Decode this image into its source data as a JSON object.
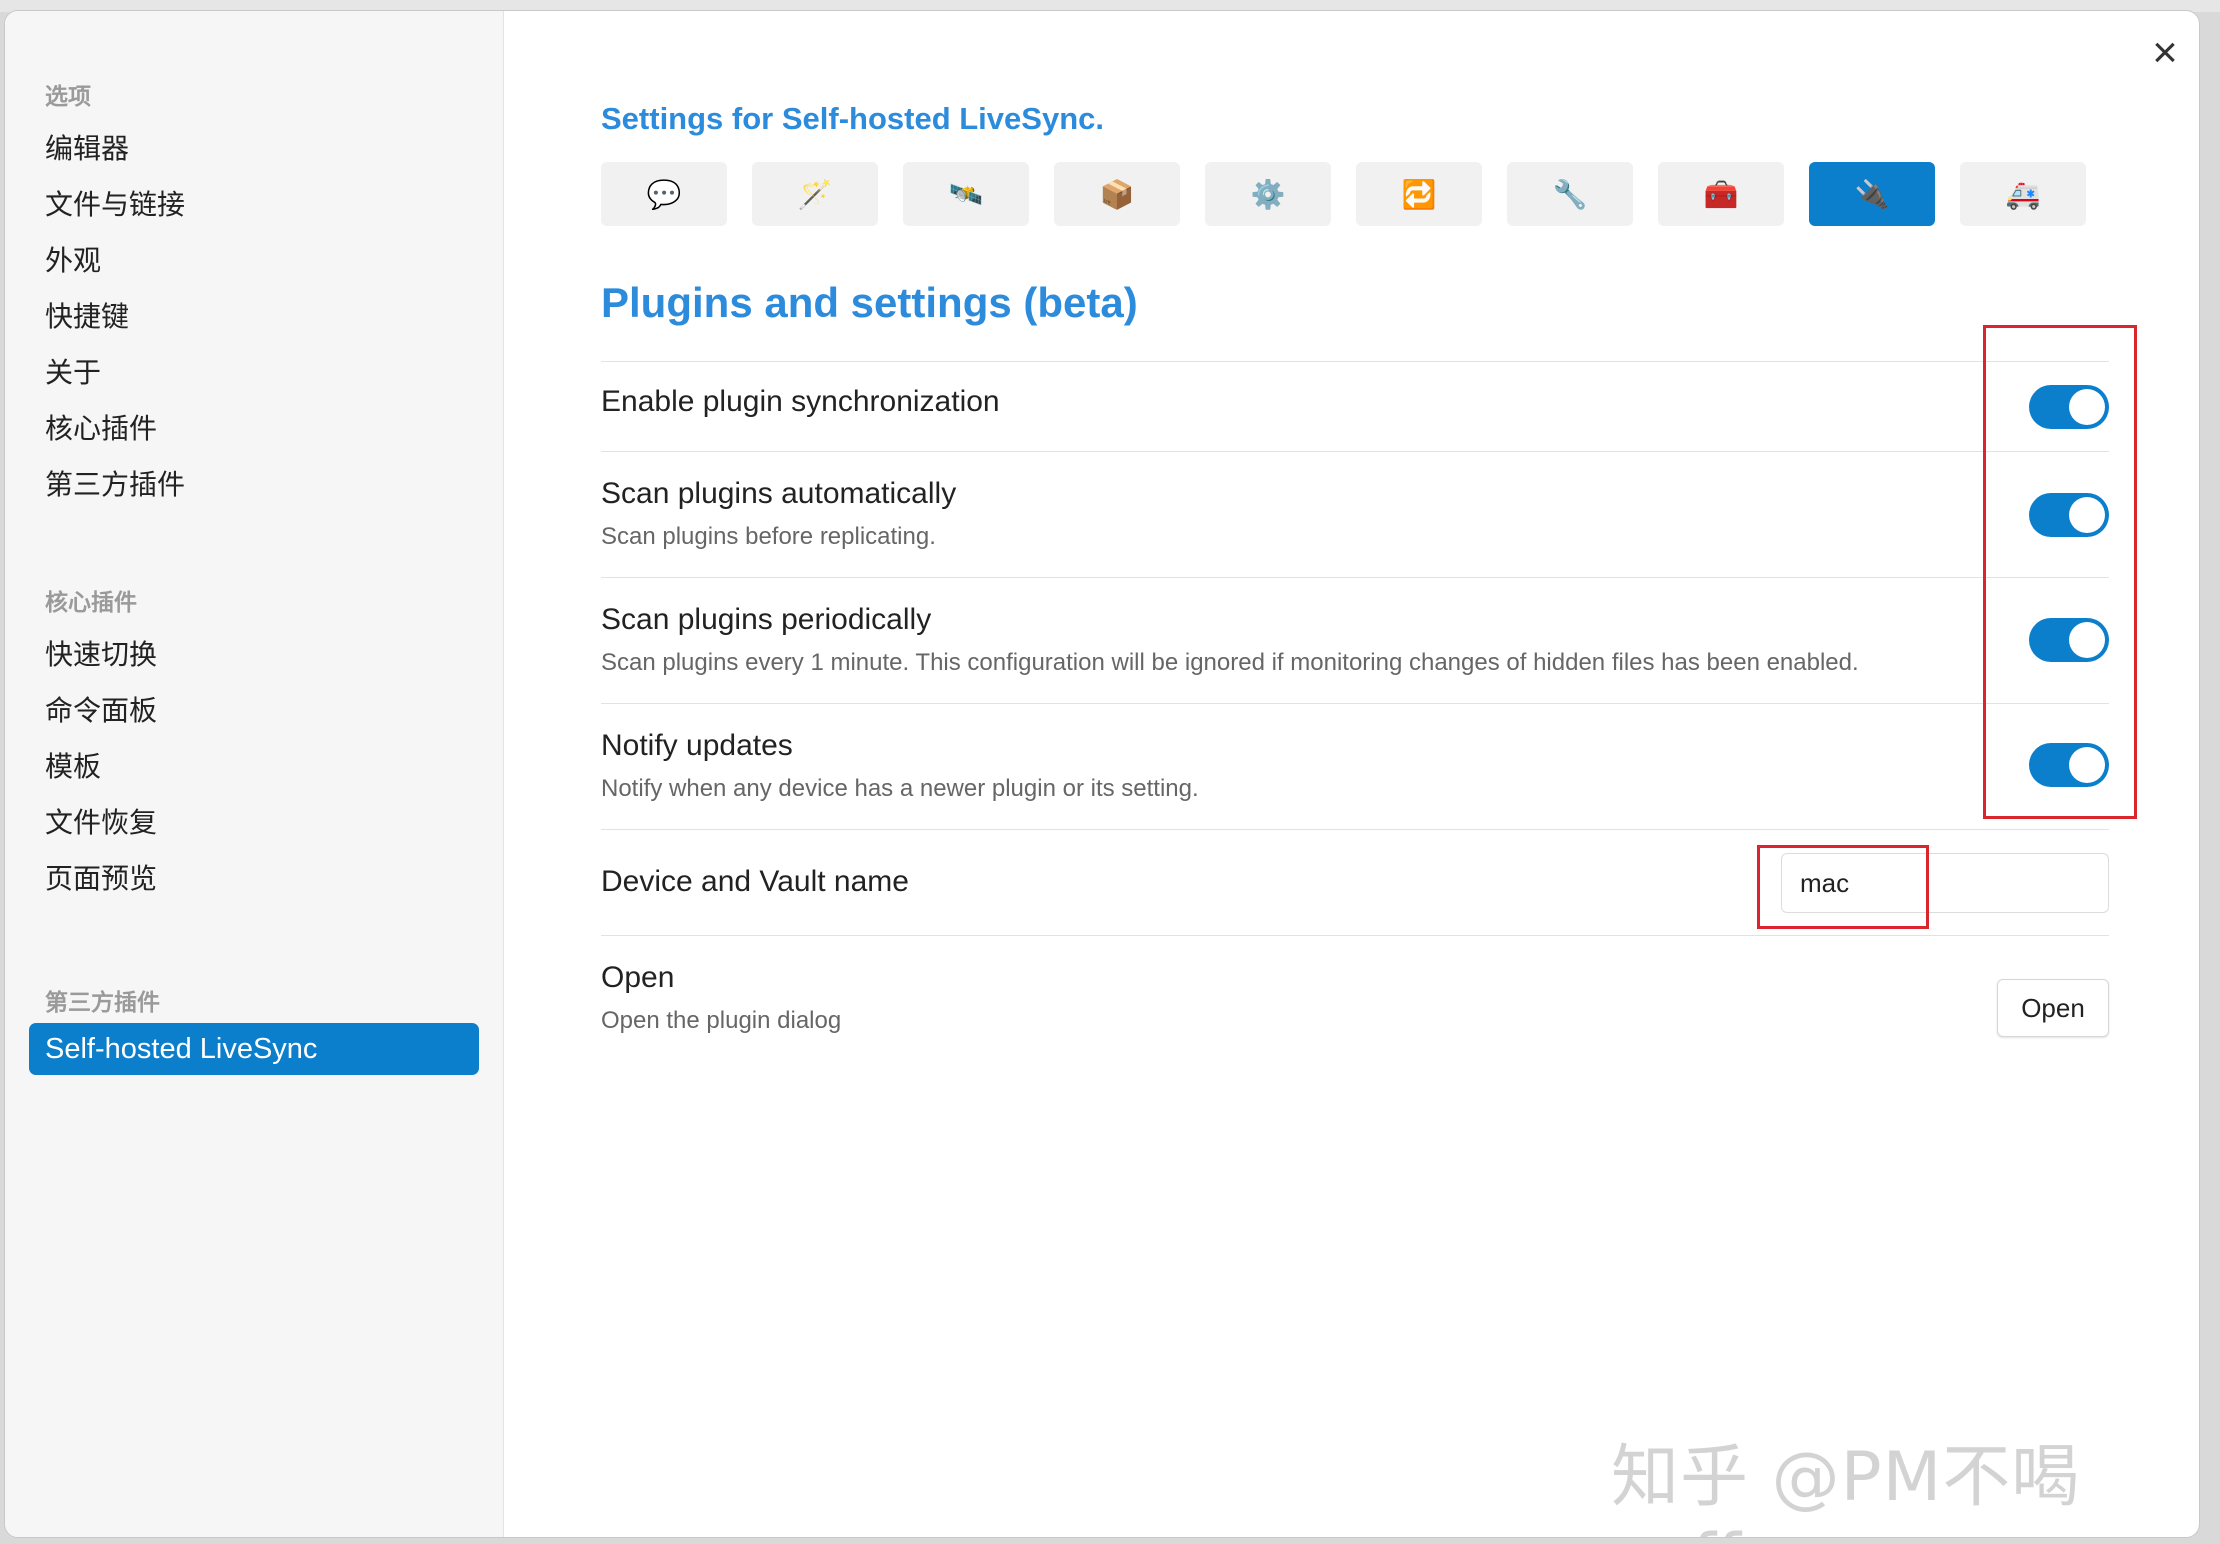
{
  "sidebar": {
    "sections": [
      {
        "heading": "选项",
        "items": [
          "编辑器",
          "文件与链接",
          "外观",
          "快捷键",
          "关于",
          "核心插件",
          "第三方插件"
        ]
      },
      {
        "heading": "核心插件",
        "items": [
          "快速切换",
          "命令面板",
          "模板",
          "文件恢复",
          "页面预览"
        ]
      },
      {
        "heading": "第三方插件",
        "items": [
          "Self-hosted LiveSync"
        ]
      }
    ]
  },
  "header": {
    "title": "Settings for Self-hosted LiveSync.",
    "close_icon": "×"
  },
  "tabs": [
    {
      "icon": "speech-balloon-icon",
      "glyph": "💬"
    },
    {
      "icon": "magic-wand-icon",
      "glyph": "🪄"
    },
    {
      "icon": "satellite-icon",
      "glyph": "🛰️"
    },
    {
      "icon": "package-icon",
      "glyph": "📦"
    },
    {
      "icon": "gear-icon",
      "glyph": "⚙️"
    },
    {
      "icon": "sync-icon",
      "glyph": "🔁"
    },
    {
      "icon": "wrench-icon",
      "glyph": "🔧"
    },
    {
      "icon": "toolbox-icon",
      "glyph": "🧰"
    },
    {
      "icon": "plug-icon",
      "glyph": "🔌",
      "active": true
    },
    {
      "icon": "ambulance-icon",
      "glyph": "🚑"
    }
  ],
  "section": {
    "title": "Plugins and settings (beta)"
  },
  "settings": [
    {
      "name": "Enable plugin synchronization",
      "desc": "",
      "toggle": true
    },
    {
      "name": "Scan plugins automatically",
      "desc": "Scan plugins before replicating.",
      "toggle": true
    },
    {
      "name": "Scan plugins periodically",
      "desc": "Scan plugins every 1 minute. This configuration will be ignored if monitoring changes of hidden files has been enabled.",
      "toggle": true
    },
    {
      "name": "Notify updates",
      "desc": "Notify when any device has a newer plugin or its setting.",
      "toggle": true
    }
  ],
  "device": {
    "name": "Device and Vault name",
    "value": "mac"
  },
  "open": {
    "name": "Open",
    "desc": "Open the plugin dialog",
    "button_label": "Open"
  },
  "watermark": "知乎 @PM不喝caff",
  "colors": {
    "accent": "#0b7fcc",
    "title_blue": "#2d8bdc",
    "highlight_red": "#d8262c"
  }
}
